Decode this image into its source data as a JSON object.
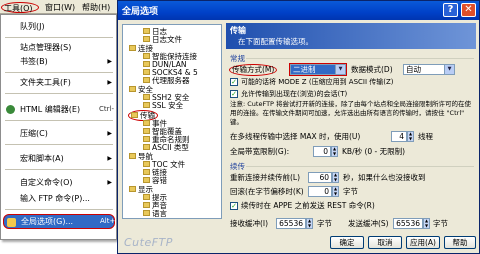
{
  "menubar": {
    "tools": "工具(O)",
    "window": "窗口(W)",
    "help": "帮助(H)"
  },
  "tools_menu": {
    "items": [
      {
        "label": "队列(J)",
        "accel": ""
      },
      {
        "label": "站点管理器(S)",
        "accel": ""
      },
      {
        "label": "书签(B)",
        "accel": ""
      },
      {
        "label": "文件夹工具(F)",
        "accel": ""
      },
      {
        "label": "HTML 编辑器(E)",
        "accel": "Ctrl-"
      },
      {
        "label": "压缩(C)",
        "accel": ""
      },
      {
        "label": "宏和脚本(A)",
        "accel": ""
      },
      {
        "label": "自定义命令(O)",
        "accel": ""
      },
      {
        "label": "输入 FTP 命令(P)...",
        "accel": ""
      },
      {
        "label": "全局选项(G)...",
        "accel": "Alt+"
      }
    ]
  },
  "dialog": {
    "title": "全局选项",
    "help_btn": "?",
    "close_btn": "✕",
    "logo": "CuteFTP",
    "tree": [
      {
        "label": "日志",
        "level": 2
      },
      {
        "label": "日志文件",
        "level": 2
      },
      {
        "label": "连接",
        "level": 1
      },
      {
        "label": "智能保持连接",
        "level": 2
      },
      {
        "label": "DUN/LAN",
        "level": 2
      },
      {
        "label": "SOCKS4 & 5",
        "level": 2
      },
      {
        "label": "代理服务器",
        "level": 2
      },
      {
        "label": "安全",
        "level": 1
      },
      {
        "label": "SSH2 安全",
        "level": 2
      },
      {
        "label": "SSL 安全",
        "level": 2
      },
      {
        "label": "传输",
        "level": 1
      },
      {
        "label": "事件",
        "level": 2
      },
      {
        "label": "智能覆盖",
        "level": 2
      },
      {
        "label": "重命名规则",
        "level": 2
      },
      {
        "label": "ASCII 类型",
        "level": 2
      },
      {
        "label": "导航",
        "level": 1
      },
      {
        "label": "TOC 文件",
        "level": 2
      },
      {
        "label": "链接",
        "level": 2
      },
      {
        "label": "容错",
        "level": 2
      },
      {
        "label": "显示",
        "level": 1
      },
      {
        "label": "提示",
        "level": 2
      },
      {
        "label": "声音",
        "level": 2
      },
      {
        "label": "语言",
        "level": 2
      }
    ],
    "header": {
      "title": "传输",
      "subtitle": "在下面配置传输选项。"
    },
    "section_general": "常规",
    "transfer_mode_label": "传输方式(M)",
    "transfer_mode_value": "二进制",
    "data_mode_label": "数据模式(D)",
    "data_mode_value": "自动",
    "opt_mode_z": "可能的话将 MODE Z (压缩应用到 ASCII 传输(Z)",
    "opt_mode_z_checked": true,
    "opt_browse": "允许传输到出现在(浏览)的会话(T)",
    "opt_browse_checked": true,
    "note": "注意: CuteFTP 将尝试打开新的连接，除了由每个站点和全局连接限制所许可的在使用的连接。在传输文件期间可加速，允许选出由所有语言的传输时，请按住 \"Ctrl\" 键。",
    "multi_part_label": "在多线程传输中选择 MAX 时，使用(U)",
    "multi_part_value": "4",
    "multi_part_unit": "线程",
    "bandwidth_label": "全局带宽限制(G):",
    "bandwidth_value": "0",
    "bandwidth_unit": "KB/秒 (0 - 无限制)",
    "section_retry": "续传",
    "retry_label": "重新连接并续传前(L)",
    "retry_value": "60",
    "retry_unit": "秒，如果什么也没接收到",
    "rollback_label": "回滚(在字节偏移时(K)",
    "rollback_value": "0",
    "rollback_unit": "字节",
    "opt_appe": "续传时在 APPE 之前发送 REST 命令(R)",
    "opt_appe_checked": true,
    "recv_buf_label": "接收缓冲(I)",
    "recv_buf_value": "65536",
    "recv_buf_unit": "字节",
    "send_buf_label": "发送缓冲(S)",
    "send_buf_value": "65536",
    "send_buf_unit": "字节",
    "ok": "确定",
    "cancel": "取消",
    "apply": "应用(A)",
    "help": "帮助"
  }
}
